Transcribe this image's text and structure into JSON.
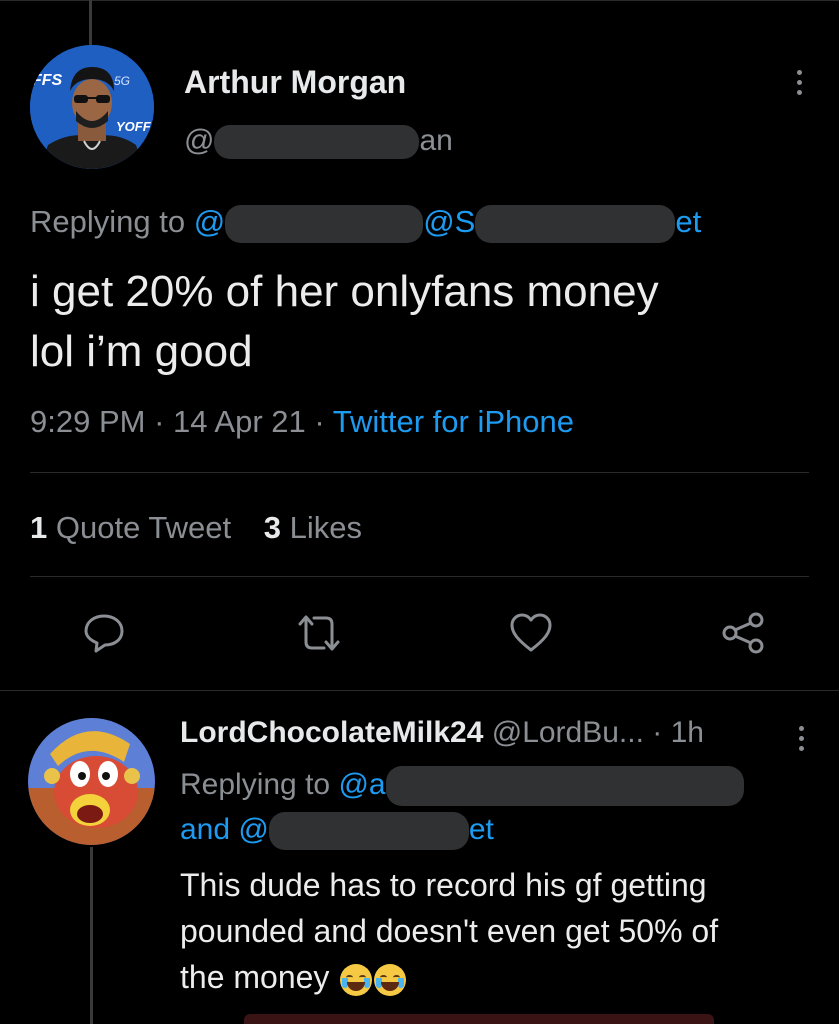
{
  "tweet": {
    "author_name": "Arthur Morgan",
    "handle_prefix": "@",
    "handle_suffix": "an",
    "replying_label": "Replying to",
    "reply_mention_1_prefix": "@",
    "reply_mention_2_prefix": "@S",
    "reply_mention_2_suffix": "et",
    "text_line1": "i get 20% of her onlyfans money",
    "text_line2": "lol i’m good",
    "time": "9:29 PM",
    "date": "14 Apr 21",
    "separator": "·",
    "source": "Twitter for iPhone",
    "quote_count": "1",
    "quote_label": "Quote Tweet",
    "like_count": "3",
    "like_label": "Likes"
  },
  "actions": {
    "reply_icon": "comment-bubble-icon",
    "retweet_icon": "retweet-arrows-icon",
    "like_icon": "heart-outline-icon",
    "share_icon": "share-nodes-icon"
  },
  "reply": {
    "author_name": "LordChocolateMilk24",
    "handle": "@LordBu...",
    "separator": "·",
    "time": "1h",
    "replying_label": "Replying to",
    "mention_1_prefix": "@a",
    "and_label": "and",
    "mention_2_prefix": "@",
    "mention_2_suffix": "et",
    "text_line1": "This dude has to record his gf getting",
    "text_line2": "pounded and doesn't even get 50% of",
    "text_line3": "the money",
    "emoji_icons": [
      "face-with-tears-of-joy-icon",
      "face-with-tears-of-joy-icon"
    ]
  },
  "colors": {
    "background": "#000000",
    "link": "#1d9bf0",
    "muted": "#8b8f94",
    "text": "#d9d9d9"
  }
}
